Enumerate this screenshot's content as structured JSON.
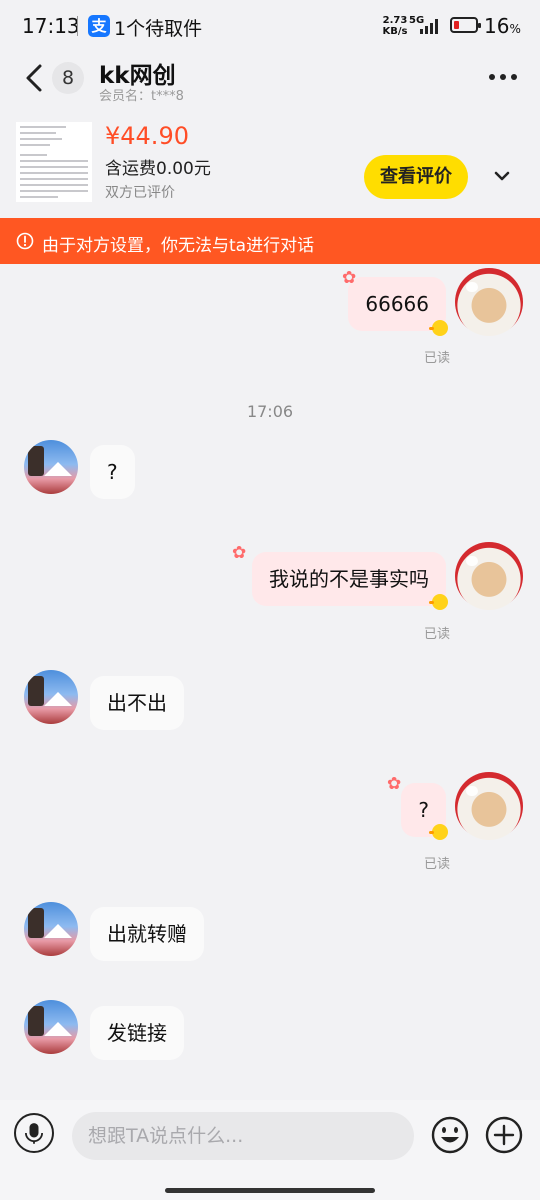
{
  "status_bar": {
    "time": "17:13",
    "notice": "1个待取件",
    "alipay_icon": "支",
    "net_speed_value": "2.73",
    "net_speed_unit": "KB/s",
    "network": "5G",
    "battery_percent": "16",
    "battery_unit": "%"
  },
  "header": {
    "unread_count": "8",
    "title": "kk网创",
    "member_label": "会员名：t***8"
  },
  "product": {
    "price": "¥44.90",
    "shipping": "含运费0.00元",
    "review_status": "双方已评价",
    "review_button": "查看评价"
  },
  "warning": {
    "text": "由于对方设置，你无法与ta进行对话"
  },
  "messages": {
    "m1": {
      "text": "66666",
      "status": "已读"
    },
    "time_sep": "17:06",
    "m2": {
      "text": "?"
    },
    "m3": {
      "text": "我说的不是事实吗",
      "status": "已读"
    },
    "m4": {
      "text": "出不出"
    },
    "m5": {
      "text": "?",
      "status": "已读"
    },
    "m6": {
      "text": "出就转赠"
    },
    "m7": {
      "text": "发链接"
    }
  },
  "composer": {
    "placeholder": "想跟TA说点什么..."
  },
  "colors": {
    "accent_warning": "#ff5722",
    "price": "#ff4d26",
    "review_button": "#ffdd00",
    "outgoing_bubble": "#ffe8ea",
    "incoming_bubble": "#fafafa"
  }
}
